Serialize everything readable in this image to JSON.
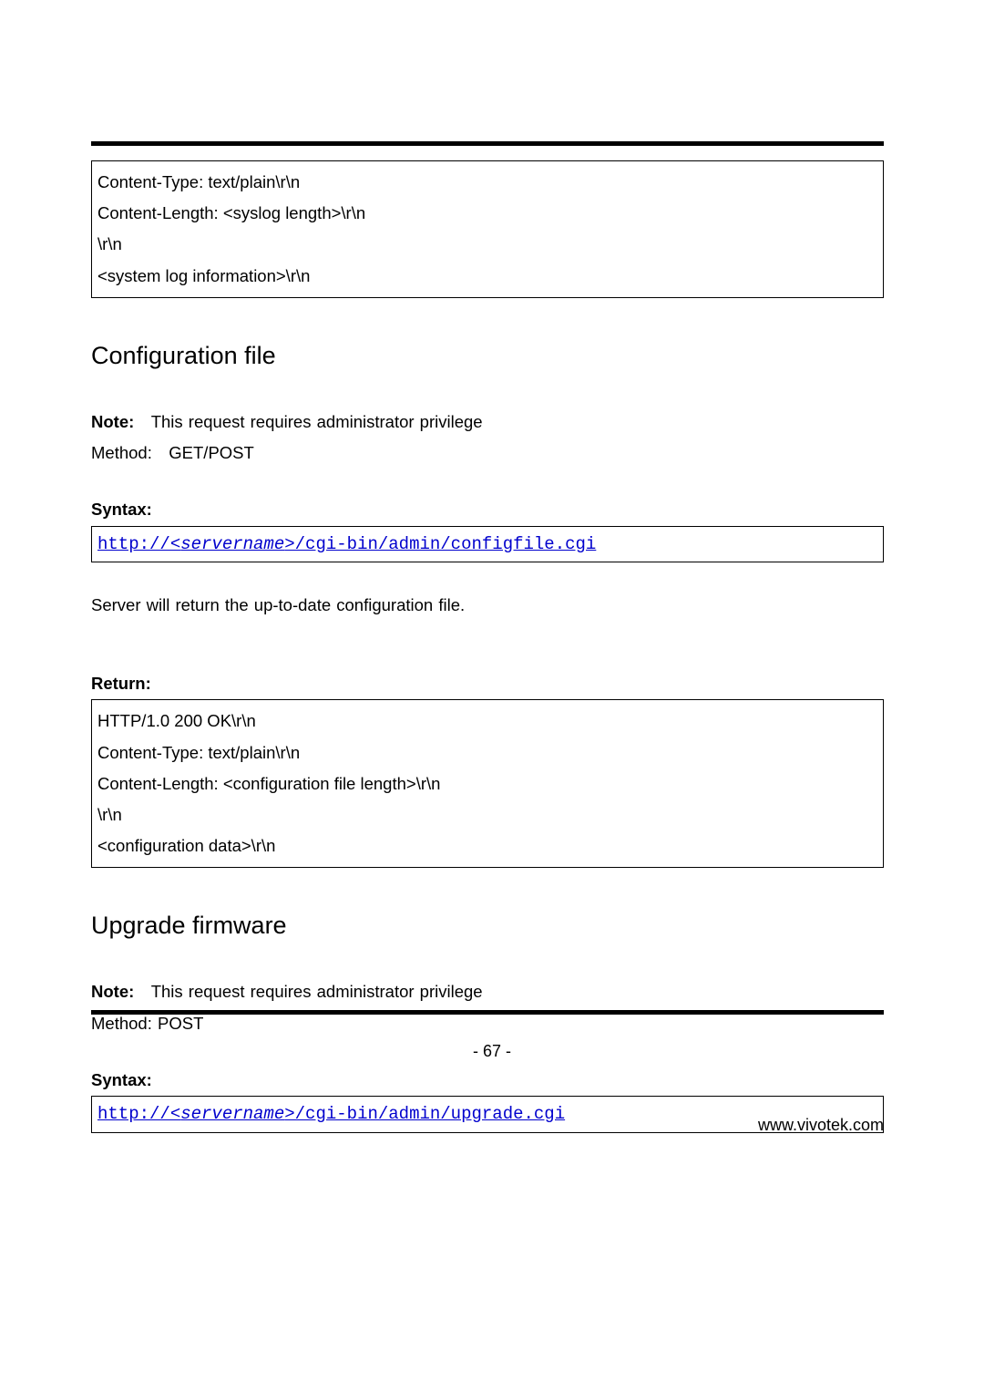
{
  "box1": {
    "line1": "Content-Type: text/plain\\r\\n",
    "line2": "Content-Length: <syslog length>\\r\\n",
    "line3": "\\r\\n",
    "line4": "<system log information>\\r\\n"
  },
  "section1": {
    "heading": "Configuration file",
    "note_label": "Note:",
    "note_text": "This request requires administrator privilege",
    "method_label": "Method:",
    "method_text": "GET/POST",
    "syntax_label": "Syntax:",
    "url_prefix": "http://<",
    "url_servername": "servername",
    "url_suffix": ">/cgi-bin/admin/configfile.cgi",
    "desc": "Server will return the up-to-date configuration file.",
    "return_label": "Return:"
  },
  "box2": {
    "line1": "HTTP/1.0 200 OK\\r\\n",
    "line2": "Content-Type: text/plain\\r\\n",
    "line3": "Content-Length: <configuration file length>\\r\\n",
    "line4": "\\r\\n",
    "line5": "<configuration data>\\r\\n"
  },
  "section2": {
    "heading": "Upgrade firmware",
    "note_label": "Note:",
    "note_text": "This request requires administrator privilege",
    "method_label": "Method:",
    "method_text": "POST",
    "syntax_label": "Syntax:",
    "url_prefix": "http://<",
    "url_servername": "servername",
    "url_suffix": ">/cgi-bin/admin/upgrade.cgi"
  },
  "page_number": "- 67 -",
  "footer_url": "www.vivotek.com"
}
